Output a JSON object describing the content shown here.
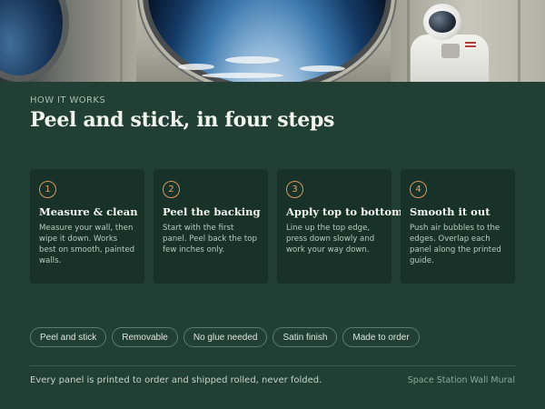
{
  "hero": {
    "image": "space-station-window-astronaut-photo"
  },
  "section": {
    "eyebrow": "HOW IT WORKS",
    "title": "Peel and stick, in four steps"
  },
  "steps": [
    {
      "number": "1",
      "title": "Measure & clean",
      "description": "Measure your wall, then wipe it down. Works best on smooth, painted walls."
    },
    {
      "number": "2",
      "title": "Peel the backing",
      "description": "Start with the first panel. Peel back the top few inches only."
    },
    {
      "number": "3",
      "title": "Apply top to bottom",
      "description": "Line up the top edge, press down slowly and work your way down."
    },
    {
      "number": "4",
      "title": "Smooth it out",
      "description": "Push air bubbles to the edges. Overlap each panel along the printed guide."
    }
  ],
  "chips": [
    "Peel and stick",
    "Removable",
    "No glue needed",
    "Satin finish",
    "Made to order"
  ],
  "footer": {
    "note": "Every panel is printed to order and shipped rolled, never folded.",
    "product": "Space Station Wall Mural"
  },
  "colors": {
    "background": "#213f35",
    "card": "#183229",
    "accent": "#d79a62",
    "chip_border": "#5c7a6e"
  }
}
